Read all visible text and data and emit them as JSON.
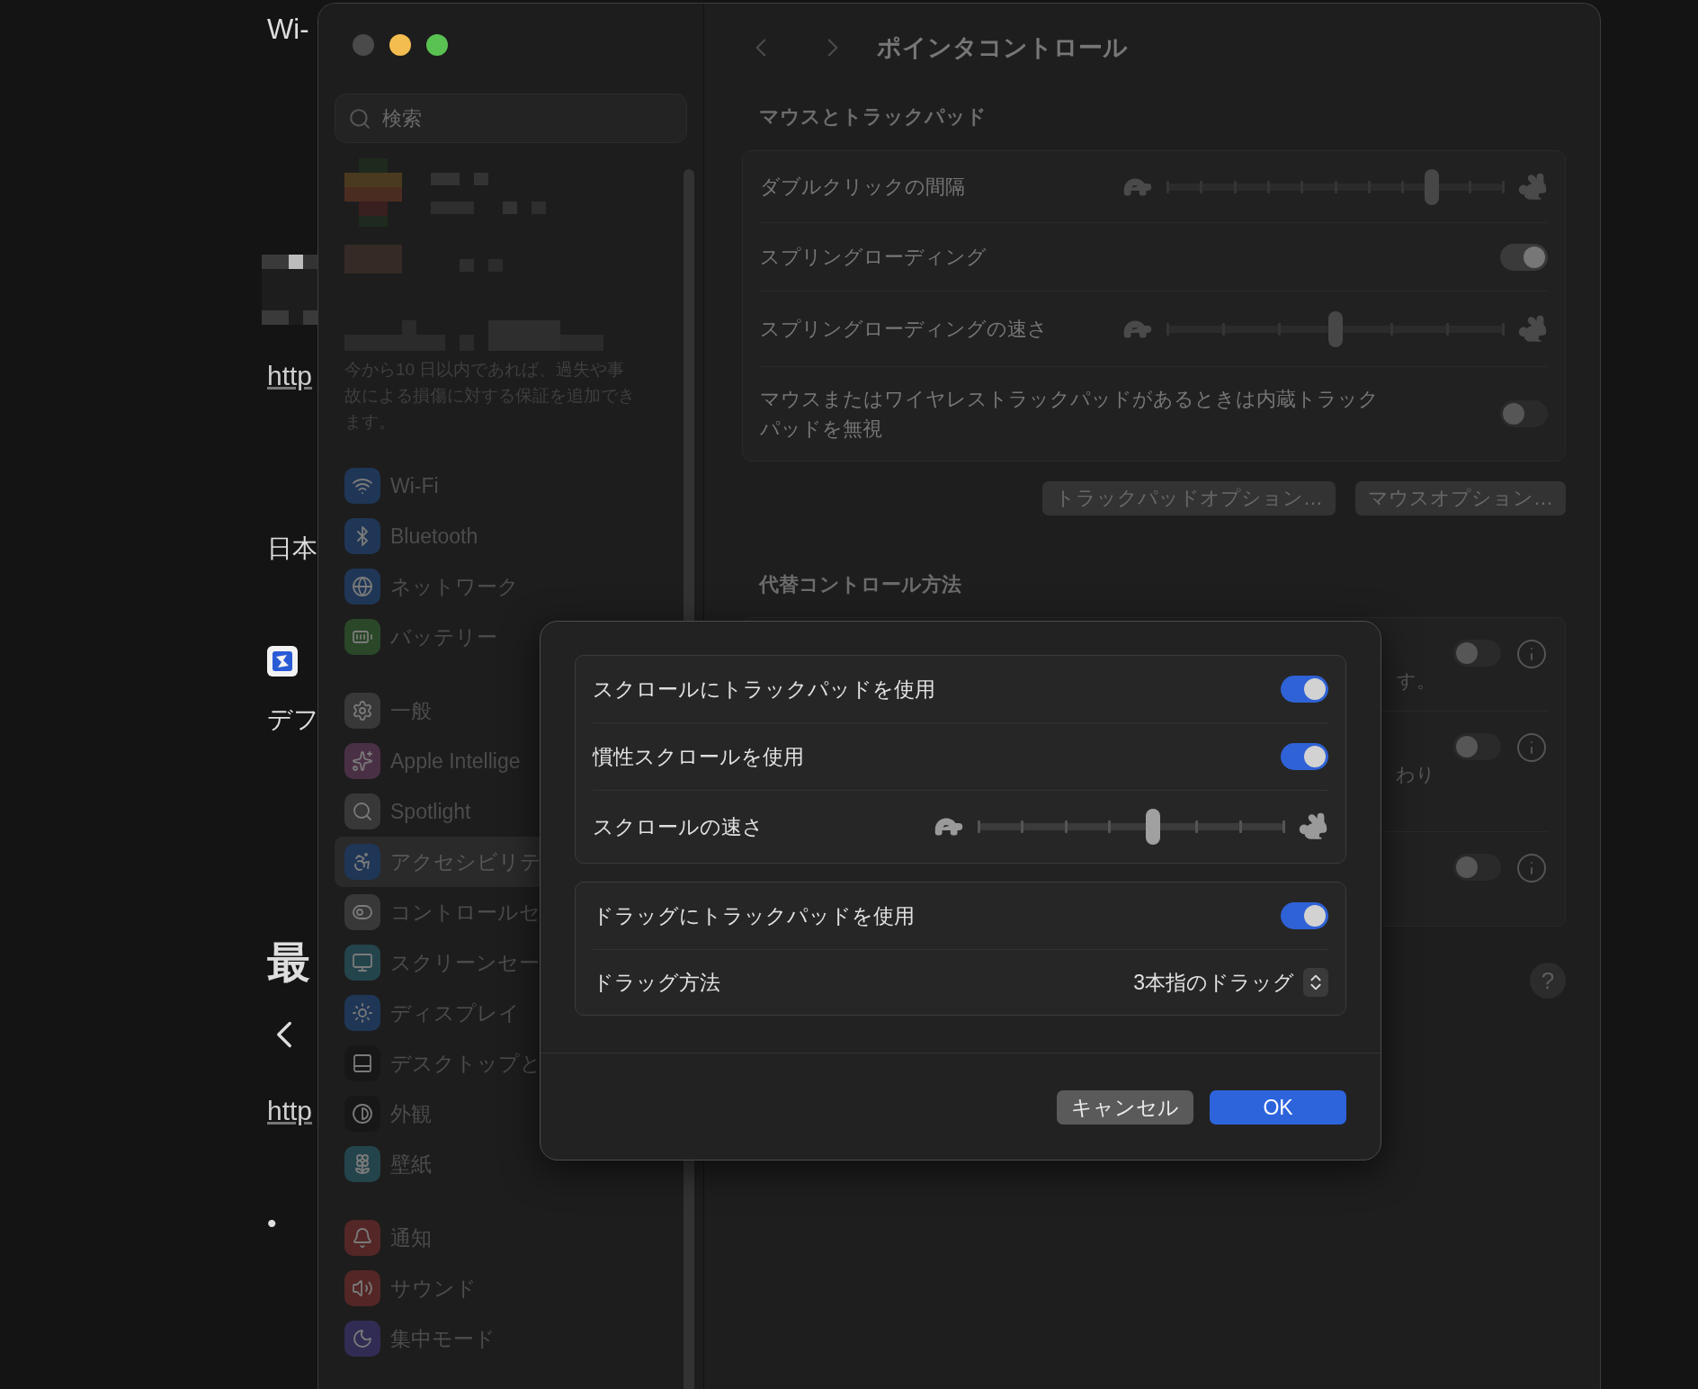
{
  "background": {
    "title": "Wi-",
    "link_top": "http",
    "text_japan": "日本",
    "text_default": "デフ",
    "heading": "最",
    "link_bottom": "http",
    "bullet": "•"
  },
  "sidebar": {
    "search": {
      "placeholder": "検索"
    },
    "notice": "今から10 日以内であれば、過失や事故による損傷に対する保証を追加できます。",
    "groups": [
      {
        "items": [
          {
            "label": "Wi-Fi",
            "kind": "wifi",
            "color": "#1f3656",
            "selected": false
          },
          {
            "label": "Bluetooth",
            "kind": "bluetooth",
            "color": "#1f3656",
            "selected": false
          },
          {
            "label": "ネットワーク",
            "kind": "globe",
            "color": "#1f3656",
            "selected": false
          },
          {
            "label": "バッテリー",
            "kind": "battery",
            "color": "#2a4728",
            "selected": false
          }
        ]
      },
      {
        "items": [
          {
            "label": "一般",
            "kind": "gear",
            "color": "#383838",
            "selected": false
          },
          {
            "label": "Apple Intellige",
            "kind": "sparkle",
            "color": "#4a3045",
            "selected": false
          },
          {
            "label": "Spotlight",
            "kind": "search",
            "color": "#383838",
            "selected": false
          },
          {
            "label": "アクセシビリテ",
            "kind": "accessibility",
            "color": "#1f3656",
            "selected": true
          },
          {
            "label": "コントロールセ",
            "kind": "switches",
            "color": "#383838",
            "selected": false
          },
          {
            "label": "スクリーンセー",
            "kind": "monitor",
            "color": "#24444c",
            "selected": false
          },
          {
            "label": "ディスプレイ",
            "kind": "sun",
            "color": "#1f3656",
            "selected": false
          },
          {
            "label": "デスクトップと",
            "kind": "dock",
            "color": "#171717",
            "selected": false
          },
          {
            "label": "外観",
            "kind": "contrast",
            "color": "#171717",
            "selected": false
          },
          {
            "label": "壁紙",
            "kind": "flower",
            "color": "#24444c",
            "selected": false
          }
        ]
      },
      {
        "items": [
          {
            "label": "通知",
            "kind": "bell",
            "color": "#542626",
            "selected": false
          },
          {
            "label": "サウンド",
            "kind": "speaker",
            "color": "#542626",
            "selected": false
          },
          {
            "label": "集中モード",
            "kind": "moon",
            "color": "#312c54",
            "selected": false
          }
        ]
      }
    ]
  },
  "content": {
    "title": "ポインタコントロール",
    "sections": [
      {
        "heading": "マウスとトラックパッド",
        "rows": [
          {
            "kind": "slider",
            "label": "ダブルクリックの間隔",
            "level": 0.787
          },
          {
            "kind": "toggle",
            "label": "スプリングローディング",
            "on": true
          },
          {
            "kind": "slider",
            "label": "スプリングローディングの速さ",
            "level": 0.5
          },
          {
            "kind": "toggle",
            "label": "マウスまたはワイヤレストラックパッドがあるときは内蔵トラックパッドを無視",
            "on": false
          }
        ],
        "buttons": [
          "トラックパッドオプション…",
          "マウスオプション…"
        ]
      },
      {
        "heading": "代替コントロール方法",
        "rows": [
          {
            "kind": "toggle_info",
            "text": "す。",
            "on": false
          },
          {
            "kind": "toggle_info",
            "text": "わり",
            "on": false
          },
          {
            "kind": "toggle_info",
            "on": false
          }
        ]
      }
    ],
    "help_button": "?"
  },
  "dialog": {
    "groups": [
      {
        "rows": [
          {
            "kind": "toggle",
            "label": "スクロールにトラックパッドを使用",
            "on": true
          },
          {
            "kind": "toggle",
            "label": "慣性スクロールを使用",
            "on": true
          },
          {
            "kind": "slider",
            "label": "スクロールの速さ",
            "level": 0.571
          }
        ]
      },
      {
        "rows": [
          {
            "kind": "toggle",
            "label": "ドラッグにトラックパッドを使用",
            "on": true
          },
          {
            "kind": "popup",
            "label": "ドラッグ方法",
            "value": "3本指のドラッグ"
          }
        ]
      }
    ],
    "buttons": [
      {
        "label": "キャンセル",
        "kind": "cancel"
      },
      {
        "label": "OK",
        "kind": "default"
      }
    ]
  }
}
